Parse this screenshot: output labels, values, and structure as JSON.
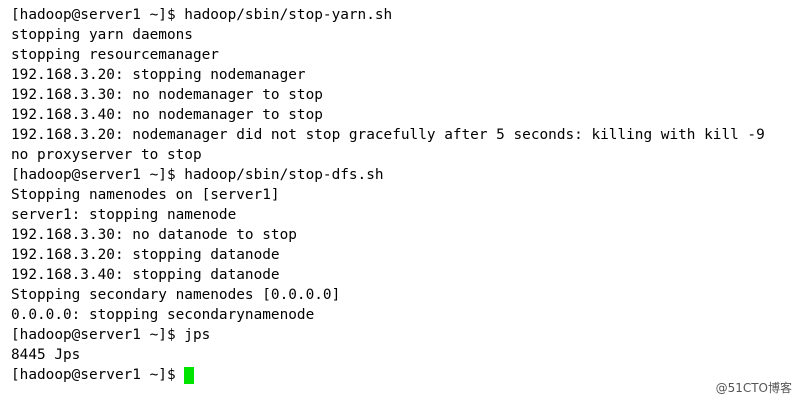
{
  "terminal": {
    "lines": [
      "[hadoop@server1 ~]$ hadoop/sbin/stop-yarn.sh",
      "stopping yarn daemons",
      "stopping resourcemanager",
      "192.168.3.20: stopping nodemanager",
      "192.168.3.30: no nodemanager to stop",
      "192.168.3.40: no nodemanager to stop",
      "192.168.3.20: nodemanager did not stop gracefully after 5 seconds: killing with kill -9",
      "no proxyserver to stop",
      "[hadoop@server1 ~]$ hadoop/sbin/stop-dfs.sh",
      "Stopping namenodes on [server1]",
      "server1: stopping namenode",
      "192.168.3.30: no datanode to stop",
      "192.168.3.20: stopping datanode",
      "192.168.3.40: stopping datanode",
      "Stopping secondary namenodes [0.0.0.0]",
      "0.0.0.0: stopping secondarynamenode",
      "[hadoop@server1 ~]$ jps",
      "8445 Jps"
    ],
    "prompt": "[hadoop@server1 ~]$",
    "cursor_color": "#00e400"
  },
  "watermark": "@51CTO博客"
}
